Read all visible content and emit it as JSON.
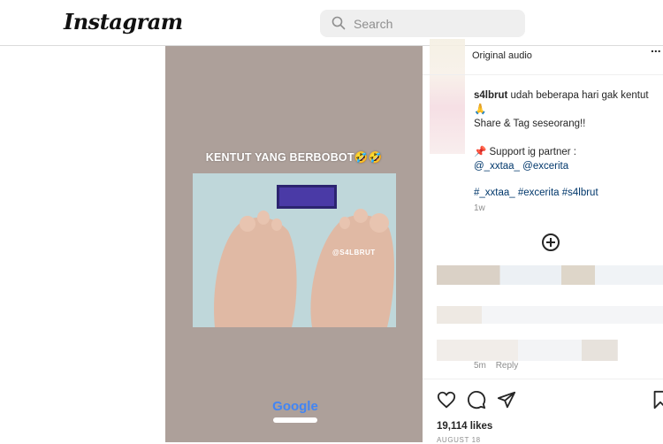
{
  "header": {
    "logo": "Instagram",
    "search_placeholder": "Search"
  },
  "video": {
    "overlay_text": "KENTUT YANG BERBOBOT🤣🤣",
    "watermark": "@S4LBRUT",
    "badge": "Google"
  },
  "post": {
    "audio_label": "Original audio",
    "more_label": "...",
    "username": "s4lbrut",
    "caption_line1": " udah beberapa hari gak kentut🙏",
    "caption_line2": "Share & Tag seseorang!!",
    "support_text": "📌 Support ig partner :",
    "partners": "@_xxtaa_ @excerita",
    "hashtags": "#_xxtaa_ #excerita #s4lbrut",
    "time_ago": "1w",
    "comment_meta_time": "5m",
    "comment_meta_reply": "Reply",
    "likes": "19,114 likes",
    "date": "AUGUST 18"
  },
  "colors": {
    "video_bg": "#ada09a",
    "link": "#00376b",
    "muted": "#8e8e8e"
  },
  "icons": [
    "search-icon",
    "heart-icon",
    "comment-icon",
    "share-icon",
    "bookmark-icon",
    "add-comment-icon",
    "more-icon"
  ]
}
